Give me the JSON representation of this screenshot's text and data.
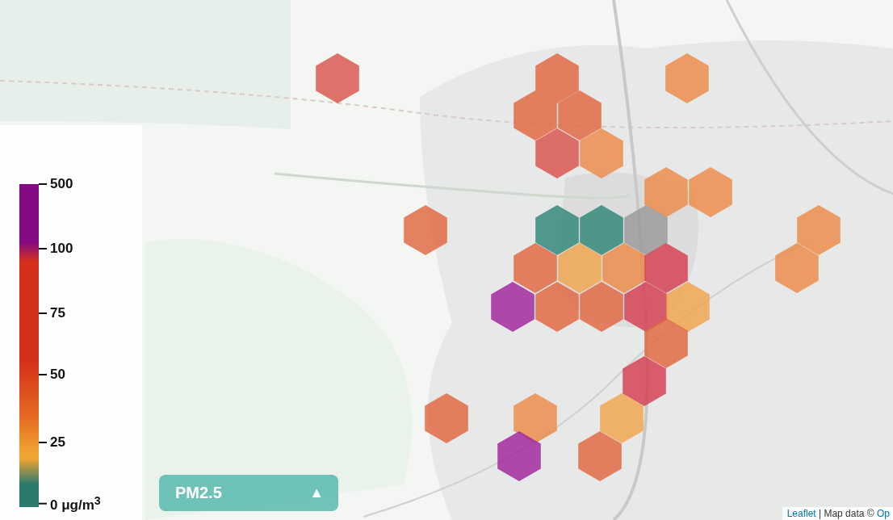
{
  "legend": {
    "ticks": [
      "500",
      "100",
      "75",
      "50",
      "25",
      "0 μg/m$^{3}$"
    ]
  },
  "pollutant_button": {
    "label": "PM2.5",
    "icon": "▲"
  },
  "attribution": {
    "leaflet_link": "Leaflet",
    "separator": " | Map data © ",
    "source_link": "Op"
  }
}
